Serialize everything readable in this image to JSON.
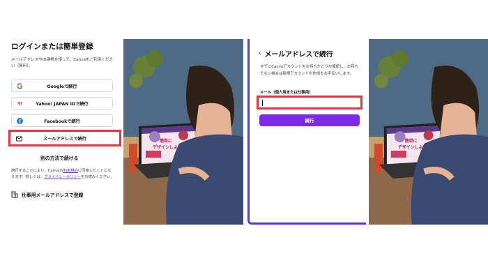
{
  "login": {
    "title": "ログインまたは簡単登録",
    "description": "メールアドレスやID連携を使って、Canvaをご利用ください（無料）。",
    "buttons": {
      "google": "Googleで続行",
      "yahoo": "Yahoo! JAPAN IDで続行",
      "facebook": "Facebookで続行",
      "email": "メールアドレスで続行"
    },
    "other_methods": "別の方法で続ける",
    "terms": {
      "part1": "続行することにより、Canvaの",
      "terms_link": "利用規約",
      "part2": "に同意したことになります。詳しくは、",
      "privacy_link": "プライバシーポリシー",
      "part3": "をお読みください。"
    },
    "work_email": "仕事用メールアドレスで登録"
  },
  "email_step": {
    "back_icon": "‹",
    "title": "メールアドレスで続行",
    "description": "すでにCanvaアカウントをお持ちかどうか確認し、お持ちでない場合は新規アカウントの作成をお手伝いします。",
    "field_label": "メール（個人用または仕事用）",
    "field_value": "",
    "continue_label": "続行"
  },
  "photo": {
    "screen_text_line1": "簡単に",
    "screen_text_line2": "デザインしよう"
  },
  "colors": {
    "accent": "#7d2ae8",
    "highlight": "#e8353b",
    "link": "#5a32fa"
  }
}
